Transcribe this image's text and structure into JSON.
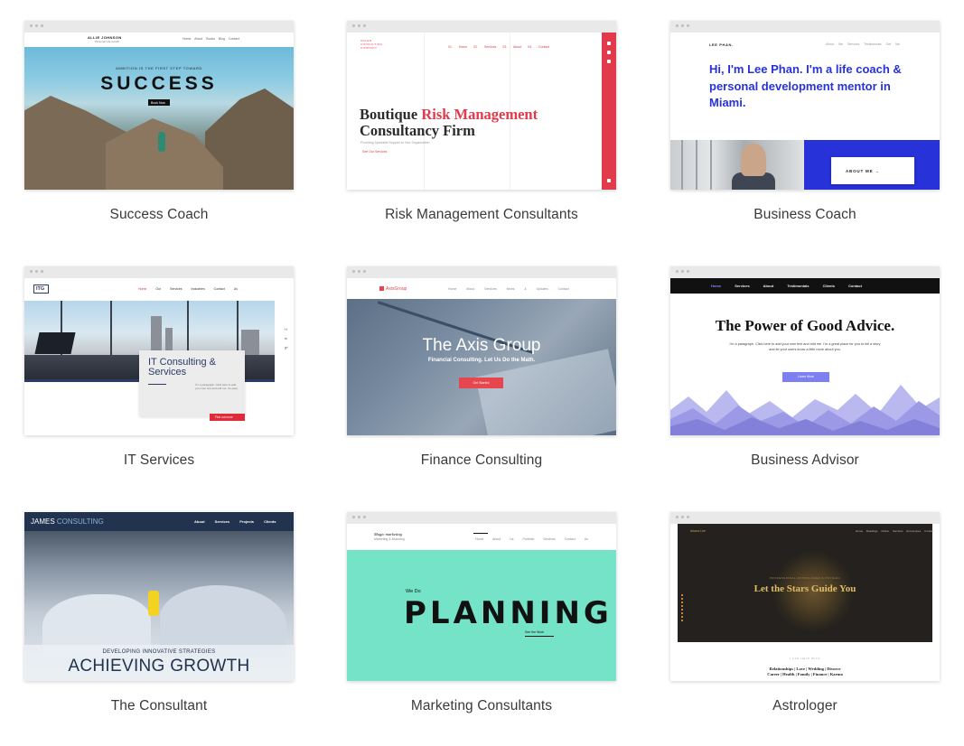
{
  "templates": [
    {
      "caption": "Success Coach",
      "screen": {
        "brand": "ALLIE JOHNSON",
        "brand_sub": "Personal Life Coach",
        "nav": "Home  About  Books  Blog  Contact",
        "eyebrow": "AMBITION IS THE FIRST STEP TOWARD",
        "headline": "SUCCESS",
        "button": "Book Now"
      }
    },
    {
      "caption": "Risk Management Consultants",
      "screen": {
        "brand": "ADLER CONSULTING COMPANY",
        "nav": "01. Home  02. Services  03. About  04. Contact",
        "headline_part1": "Boutique ",
        "headline_accent": "Risk Management",
        "headline_part2": "Consultancy Firm",
        "subtitle": "Providing Specialist Support to Your Organization",
        "cta": "See Our Services",
        "social": [
          "f",
          "t",
          "g+"
        ]
      }
    },
    {
      "caption": "Business Coach",
      "screen": {
        "brand": "LEE PHAN.",
        "nav": "About Me  Services  Testimonials  Get Me",
        "headline": "Hi, I'm Lee Phan. I'm a life coach & personal development mentor in Miami.",
        "button": "ABOUT ME →"
      }
    },
    {
      "caption": "IT Services",
      "screen": {
        "logo": "ITG",
        "nav_active": "Home",
        "nav": "Our Services  Industries  Contact Us",
        "card_title": "IT Consulting & Services",
        "card_text": "I'm a paragraph. Click here to add your own text and edit me. It's easy.",
        "button": "Find out more",
        "social": "f t in g+"
      }
    },
    {
      "caption": "Finance Consulting",
      "screen": {
        "logo": "AxisGroup",
        "nav": "Home  About  Services  News & Updates  Contact",
        "headline": "The Axis Group",
        "subtitle": "Financial Consulting. Let Us Do the Math.",
        "button": "Get Started"
      }
    },
    {
      "caption": "Business Advisor",
      "screen": {
        "nav_active": "Home",
        "nav": "Services  About  Testimonials  Clients  Contact",
        "headline": "The Power of Good Advice.",
        "paragraph_line1": "I'm a paragraph. Click here to add your own text and edit me. I'm a great place for you to tell a story",
        "paragraph_line2": "and let your users know a little more about you.",
        "button": "Learn More"
      }
    },
    {
      "caption": "The Consultant",
      "screen": {
        "brand_part1": "JAMES ",
        "brand_part2": "CONSULTING",
        "nav": "About  Services  Projects  Clients",
        "tagline": "DEVELOPING INNOVATIVE STRATEGIES",
        "headline": "ACHIEVING GROWTH"
      }
    },
    {
      "caption": "Marketing Consultants",
      "screen": {
        "brand": "Magic marketing",
        "brand_sub": "Marketing & Branding",
        "nav": "Home  About Us  Portfolio  Services  Contact Us",
        "pre": "We Do",
        "headline": "PLANNING",
        "link": "See the Work"
      }
    },
    {
      "caption": "Astrologer",
      "screen": {
        "brand": "Ariana Lee",
        "nav": "Home  Readings  Online Services  Horoscopes  Contact",
        "pre": "PROFESSIONAL ASTROLOGER & PSYCHIC",
        "headline": "Let the Stars Guide You",
        "footer_pre": "I CAN HELP WITH",
        "footer_line1": "Relationships  |  Love  |  Wedding  |  Divorce",
        "footer_line2": "Career  |  Health  |  Family  |  Finance  |  Karma"
      }
    }
  ]
}
